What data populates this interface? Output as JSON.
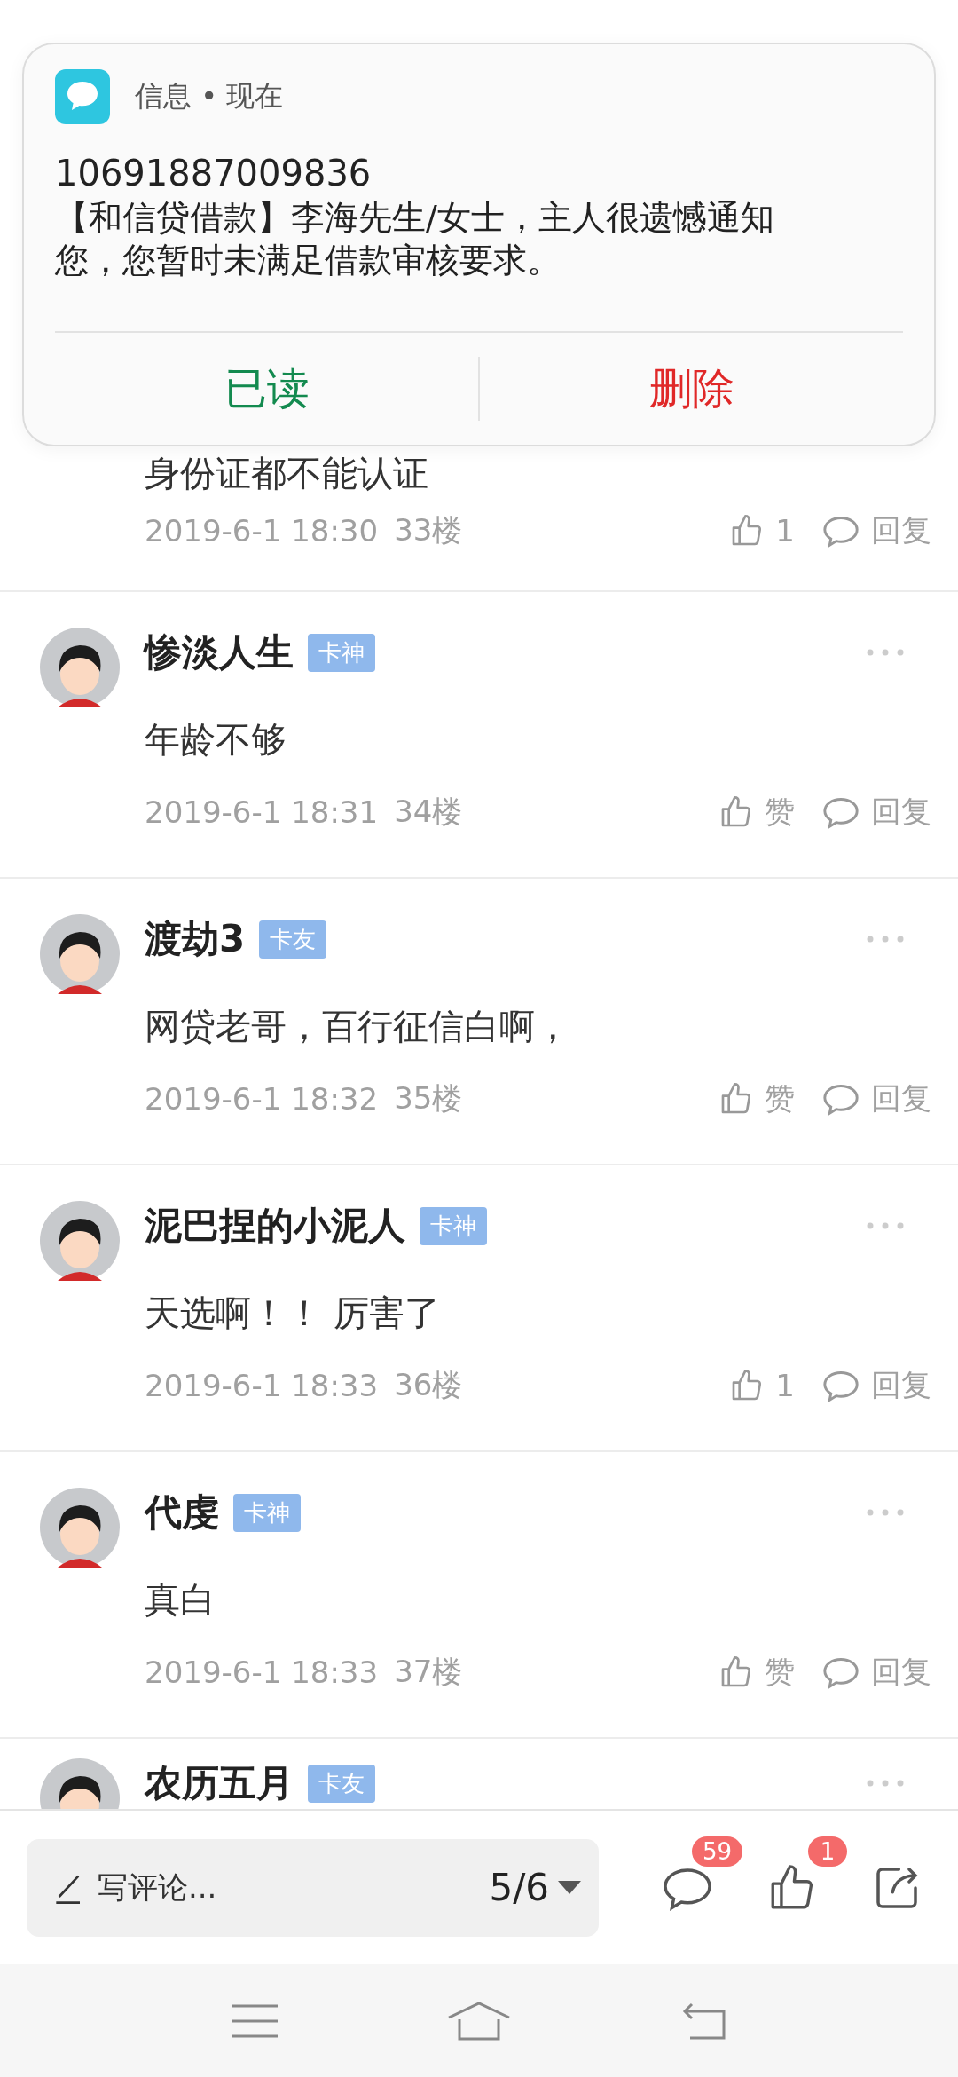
{
  "notification": {
    "header": "信息 • 现在",
    "sender": "10691887009836",
    "message": "【和信贷借款】李海先生/女士，主人很遗憾通知您，您暂时未满足借款审核要求。",
    "actions": [
      {
        "label": "已读",
        "kind": "confirm"
      },
      {
        "label": "删除",
        "kind": "danger"
      }
    ]
  },
  "comments": [
    {
      "kind": "partial",
      "text": "身份证都不能认证",
      "time": "2019-6-1 18:30",
      "floor": "33楼",
      "like_label": "1",
      "reply_label": "回复"
    },
    {
      "kind": "full",
      "name": "惨淡人生",
      "badge": "卡神",
      "text": "年龄不够",
      "time": "2019-6-1 18:31",
      "floor": "34楼",
      "like_label": "赞",
      "reply_label": "回复"
    },
    {
      "kind": "full",
      "name": "渡劫3",
      "badge": "卡友",
      "text": "网贷老哥，百行征信白啊，",
      "time": "2019-6-1 18:32",
      "floor": "35楼",
      "like_label": "赞",
      "reply_label": "回复"
    },
    {
      "kind": "full",
      "name": "泥巴捏的小泥人",
      "badge": "卡神",
      "text": "天选啊！！ 厉害了",
      "time": "2019-6-1 18:33",
      "floor": "36楼",
      "like_label": "1",
      "reply_label": "回复"
    },
    {
      "kind": "full",
      "name": "代虔",
      "badge": "卡神",
      "text": "真白",
      "time": "2019-6-1 18:33",
      "floor": "37楼",
      "like_label": "赞",
      "reply_label": "回复"
    },
    {
      "kind": "header",
      "name": "农历五月",
      "badge": "卡友"
    }
  ],
  "bottom_bar": {
    "placeholder": "写评论...",
    "page": "5/6",
    "comment_count": "59",
    "like_count": "1"
  }
}
